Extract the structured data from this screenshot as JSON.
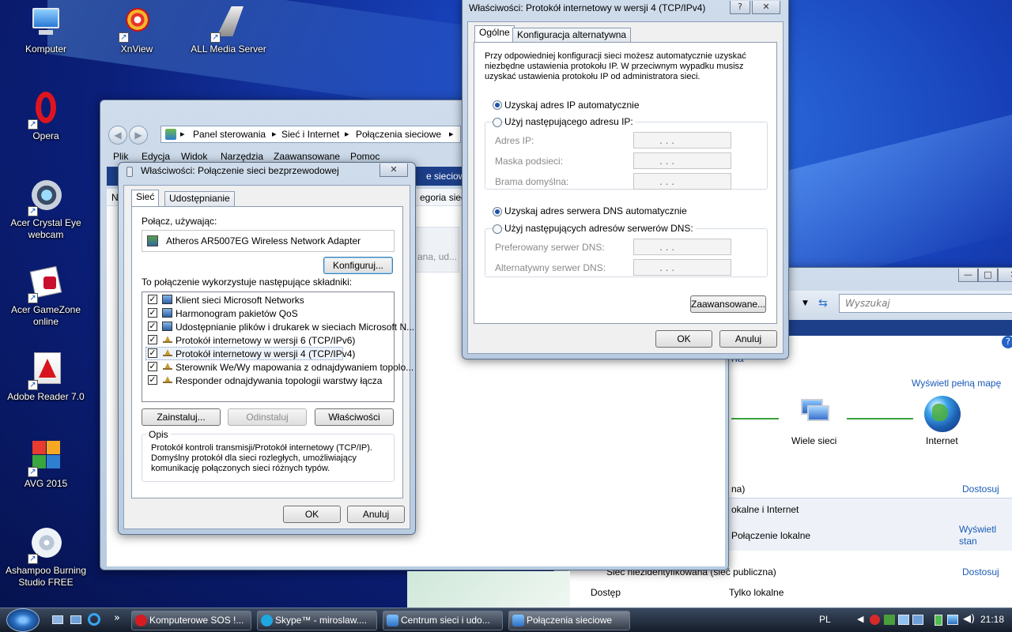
{
  "desktop": {
    "icons": [
      {
        "label": "Komputer"
      },
      {
        "label": "XnView"
      },
      {
        "label": "ALL Media Server"
      },
      {
        "label": "Opera"
      },
      {
        "label": "Acer Crystal Eye webcam"
      },
      {
        "label": "Acer GameZone online"
      },
      {
        "label": "Adobe Reader 7.0"
      },
      {
        "label": "AVG 2015"
      },
      {
        "label": "Ashampoo Burning Studio FREE"
      }
    ]
  },
  "explorer": {
    "breadcrumb": [
      "Panel sterowania",
      "Sieć i Internet",
      "Połączenia sieciowe"
    ],
    "menu": [
      "Plik",
      "Edycja",
      "Widok",
      "Narzędzia",
      "Zaawansowane",
      "Pomoc"
    ],
    "toolbar_fragments": [
      "N",
      "egoria sieci",
      "e sieciow"
    ],
    "faded_text": "ana, ud..."
  },
  "network_center": {
    "search_placeholder": "Wyszukaj",
    "heading_fragment": "na",
    "full_map_link": "Wyświetl pełną mapę",
    "nodes": [
      "Wiele sieci",
      "Internet"
    ],
    "rows": [
      {
        "label": "na)",
        "action": "Dostosuj"
      },
      {
        "label": "okalne i Internet"
      },
      {
        "label": "Połączenie lokalne",
        "action_line1": "Wyświetl",
        "action_line2": "stan"
      },
      {
        "label": "Sieć niezidentyfikowana (sieć publiczna)",
        "action": "Dostosuj"
      },
      {
        "label": "Dostęp",
        "value": "Tylko lokalne"
      }
    ]
  },
  "wlan_props": {
    "title": "Właściwości: Połączenie sieci bezprzewodowej",
    "tabs": [
      "Sieć",
      "Udostępnianie"
    ],
    "connect_using_label": "Połącz, używając:",
    "adapter": "Atheros AR5007EG Wireless Network Adapter",
    "configure_button": "Konfiguruj...",
    "components_label": "To połączenie wykorzystuje następujące składniki:",
    "components": [
      {
        "label": "Klient sieci Microsoft Networks",
        "checked": true
      },
      {
        "label": "Harmonogram pakietów QoS",
        "checked": true
      },
      {
        "label": "Udostępnianie plików i drukarek w sieciach Microsoft N...",
        "checked": true
      },
      {
        "label": "Protokół internetowy w wersji 6 (TCP/IPv6)",
        "checked": true
      },
      {
        "label": "Protokół internetowy w wersji 4 (TCP/IPv4)",
        "checked": true
      },
      {
        "label": "Sterownik We/Wy mapowania z odnajdywaniem topolo...",
        "checked": true
      },
      {
        "label": "Responder odnajdywania topologii warstwy łącza",
        "checked": true
      }
    ],
    "install_button": "Zainstaluj...",
    "uninstall_button": "Odinstaluj",
    "properties_button": "Właściwości",
    "description_label": "Opis",
    "description": "Protokół kontroli transmisji/Protokół internetowy (TCP/IP). Domyślny protokół dla sieci rozległych, umożliwiający komunikację połączonych sieci różnych typów.",
    "ok_button": "OK",
    "cancel_button": "Anuluj"
  },
  "ipv4_props": {
    "title": "Właściwości: Protokół internetowy w wersji 4 (TCP/IPv4)",
    "help_button": "?",
    "close_button": "✕",
    "tabs": [
      "Ogólne",
      "Konfiguracja alternatywna"
    ],
    "intro_line1": "Przy odpowiedniej konfiguracji sieci możesz automatycznie uzyskać",
    "intro_line2": "niezbędne ustawienia protokołu IP. W przeciwnym wypadku musisz",
    "intro_line3": "uzyskać ustawienia protokołu IP od administratora sieci.",
    "auto_ip": "Uzyskaj adres IP automatycznie",
    "manual_ip": "Użyj następującego adresu IP:",
    "ip_fields": [
      "Adres IP:",
      "Maska podsieci:",
      "Brama domyślna:"
    ],
    "auto_dns": "Uzyskaj adres serwera DNS automatycznie",
    "manual_dns": "Użyj następujących adresów serwerów DNS:",
    "dns_fields": [
      "Preferowany serwer DNS:",
      "Alternatywny serwer DNS:"
    ],
    "ip_placeholder": ".       .       .",
    "advanced_button": "Zaawansowane...",
    "ok_button": "OK",
    "cancel_button": "Anuluj"
  },
  "taskbar": {
    "tasks": [
      "Komputerowe SOS !...",
      "Skype™ - miroslaw....",
      "Centrum sieci i udo...",
      "Połączenia sieciowe"
    ],
    "overflow": "»",
    "language": "PL",
    "time": "21:18"
  }
}
